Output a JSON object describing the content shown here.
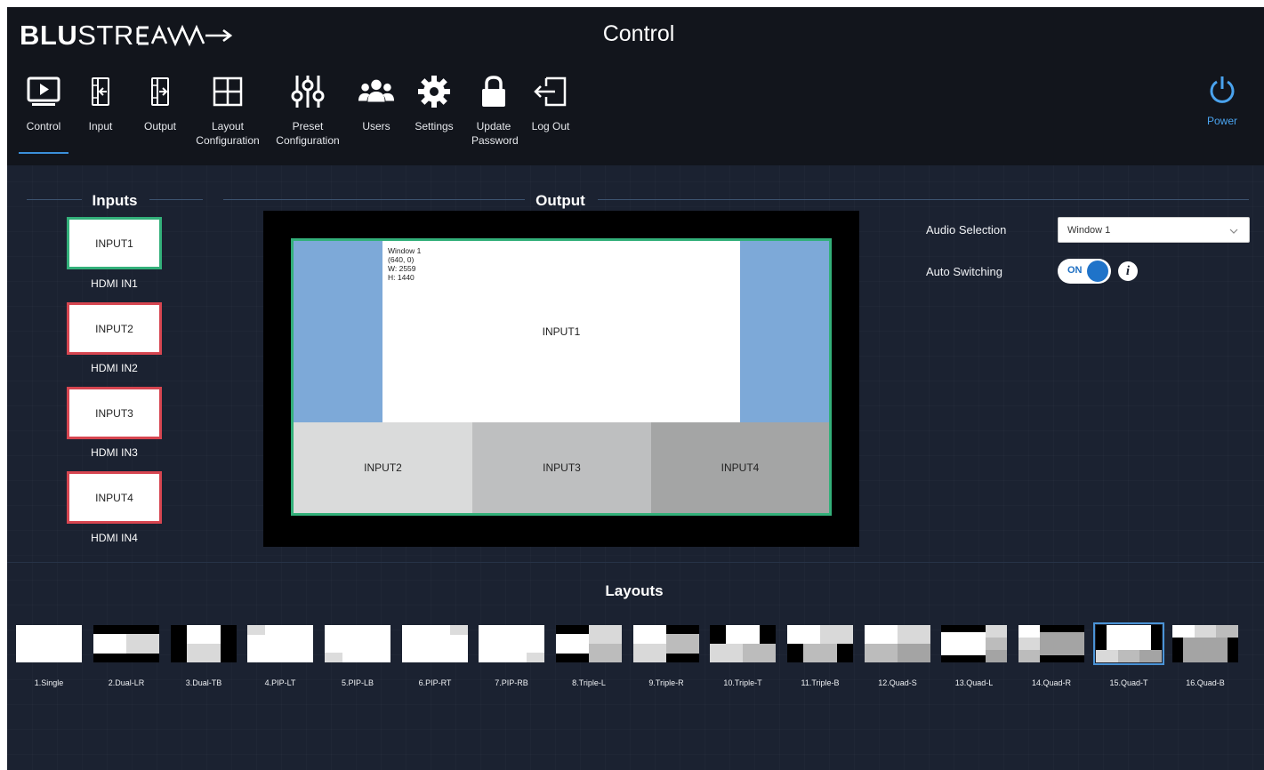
{
  "brand": {
    "bold": "BLU",
    "light": "STREAM"
  },
  "page_title": "Control",
  "nav": [
    {
      "id": "control",
      "label": "Control",
      "icon": "monitor-play-icon"
    },
    {
      "id": "input",
      "label": "Input",
      "icon": "input-icon"
    },
    {
      "id": "output",
      "label": "Output",
      "icon": "output-icon"
    },
    {
      "id": "layout",
      "label": "Layout Configuration",
      "icon": "grid-icon"
    },
    {
      "id": "preset",
      "label": "Preset Configuration",
      "icon": "sliders-icon"
    },
    {
      "id": "users",
      "label": "Users",
      "icon": "users-icon"
    },
    {
      "id": "settings",
      "label": "Settings",
      "icon": "gear-icon"
    },
    {
      "id": "password",
      "label": "Update Password",
      "icon": "lock-icon"
    },
    {
      "id": "logout",
      "label": "Log Out",
      "icon": "logout-icon"
    }
  ],
  "power_label": "Power",
  "sections": {
    "inputs": "Inputs",
    "output": "Output",
    "layouts": "Layouts"
  },
  "inputs": [
    {
      "label": "INPUT1",
      "name": "HDMI IN1",
      "selected": true
    },
    {
      "label": "INPUT2",
      "name": "HDMI IN2",
      "selected": false
    },
    {
      "label": "INPUT3",
      "name": "HDMI IN3",
      "selected": false
    },
    {
      "label": "INPUT4",
      "name": "HDMI IN4",
      "selected": false
    }
  ],
  "windows": {
    "w1": {
      "label": "INPUT1",
      "info": [
        "Window 1",
        "(640, 0)",
        "W: 2559",
        "H: 1440"
      ]
    },
    "w2": {
      "label": "INPUT2"
    },
    "w3": {
      "label": "INPUT3"
    },
    "w4": {
      "label": "INPUT4"
    }
  },
  "audio": {
    "label": "Audio Selection",
    "value": "Window 1"
  },
  "auto_switching": {
    "label": "Auto Switching",
    "state": "ON"
  },
  "layouts": [
    "1.Single",
    "2.Dual-LR",
    "3.Dual-TB",
    "4.PIP-LT",
    "5.PIP-LB",
    "6.PIP-RT",
    "7.PIP-RB",
    "8.Triple-L",
    "9.Triple-R",
    "10.Triple-T",
    "11.Triple-B",
    "12.Quad-S",
    "13.Quad-L",
    "14.Quad-R",
    "15.Quad-T",
    "16.Quad-B"
  ],
  "selected_layout": "15.Quad-T",
  "colors": {
    "accent": "#3b8fd9",
    "selected_input": "#33b07a",
    "unselected_input": "#d64550",
    "canvas_bg": "#7da9d8"
  }
}
